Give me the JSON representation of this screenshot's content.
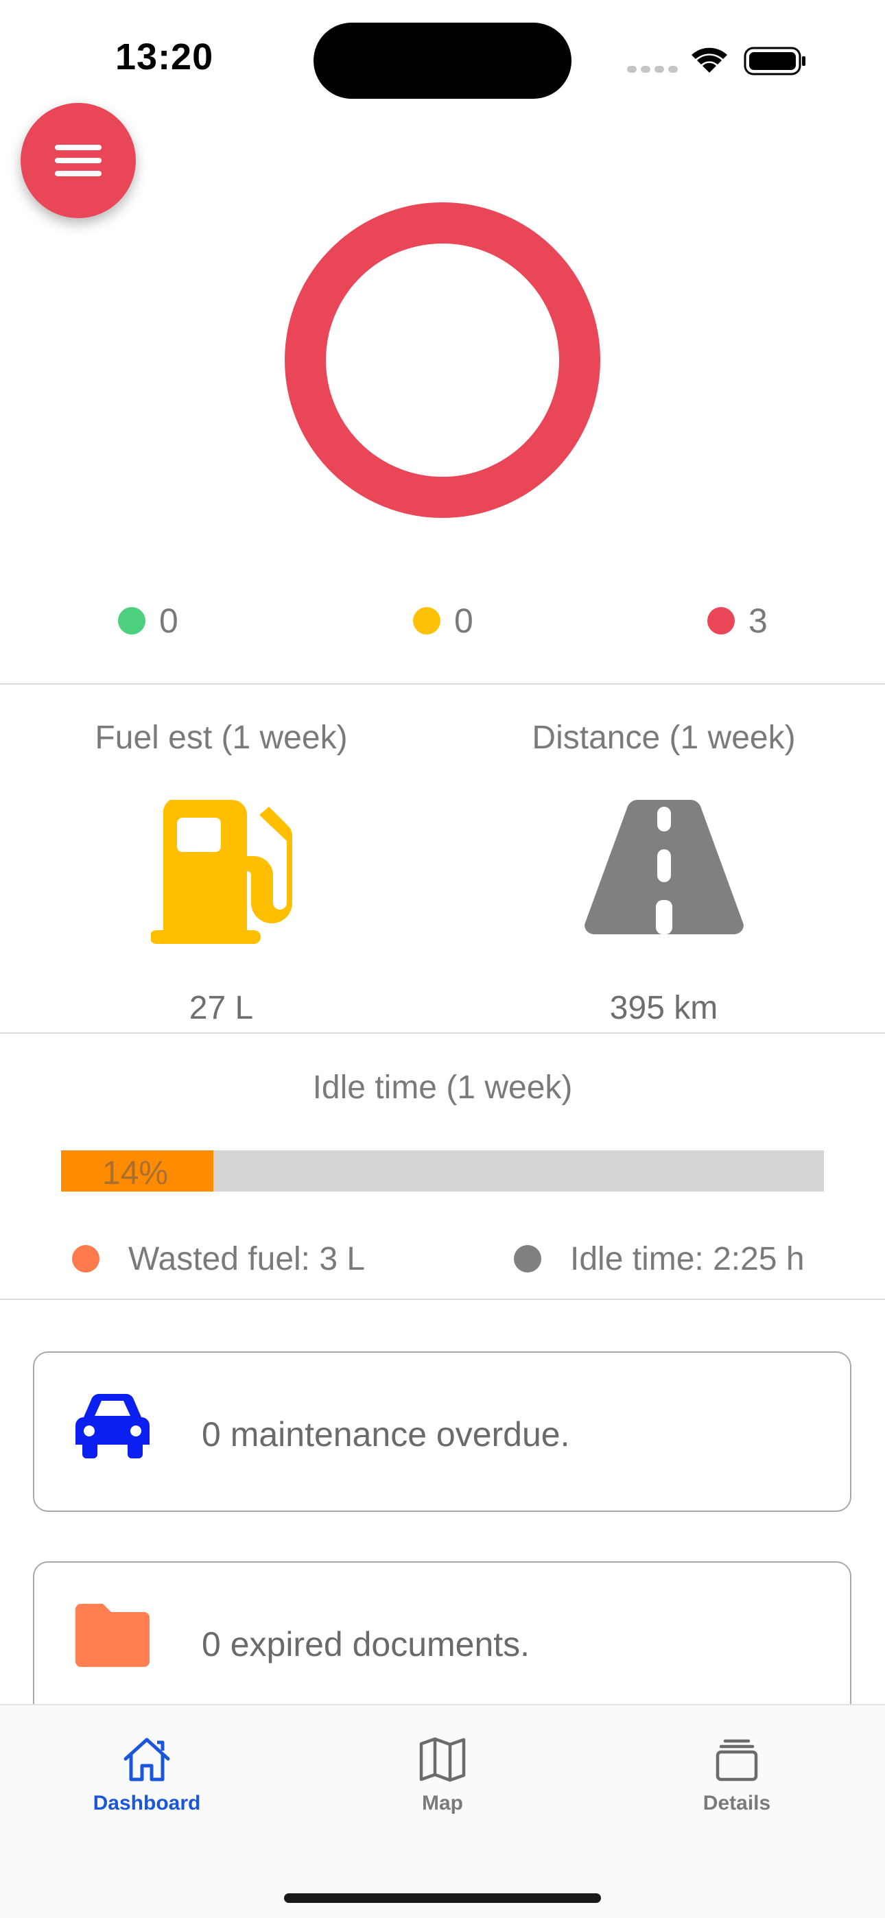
{
  "status_bar": {
    "time": "13:20"
  },
  "colors": {
    "accent": "#e94658",
    "green": "#4cd07d",
    "yellow": "#ffc107",
    "red": "#e94658",
    "fuel": "#ffbf00",
    "road": "#808080",
    "idle_fill": "#ff8c00",
    "wasted": "#ff7a4d",
    "idle_gray": "#808080",
    "car": "#0a1ff0",
    "folder": "#ff7f50",
    "tab_active": "#1a56db"
  },
  "summary": {
    "legend": [
      {
        "color": "green",
        "count": "0"
      },
      {
        "color": "yellow",
        "count": "0"
      },
      {
        "color": "red",
        "count": "3"
      }
    ]
  },
  "fuel": {
    "title": "Fuel est (1 week)",
    "value": "27 L",
    "icon": "fuel-pump-icon"
  },
  "distance": {
    "title": "Distance (1 week)",
    "value": "395 km",
    "icon": "road-icon"
  },
  "idle": {
    "title": "Idle time (1 week)",
    "percent_label": "14%",
    "percent": 0.2,
    "wasted_fuel": "Wasted fuel: 3 L",
    "idle_time": "Idle time: 2:25 h"
  },
  "cards": {
    "maintenance": {
      "text": "0 maintenance overdue.",
      "icon": "car-icon"
    },
    "documents": {
      "text": "0 expired documents.",
      "icon": "folder-icon"
    }
  },
  "tabs": [
    {
      "label": "Dashboard",
      "icon": "home-icon",
      "active": true
    },
    {
      "label": "Map",
      "icon": "map-icon",
      "active": false
    },
    {
      "label": "Details",
      "icon": "stack-icon",
      "active": false
    }
  ]
}
